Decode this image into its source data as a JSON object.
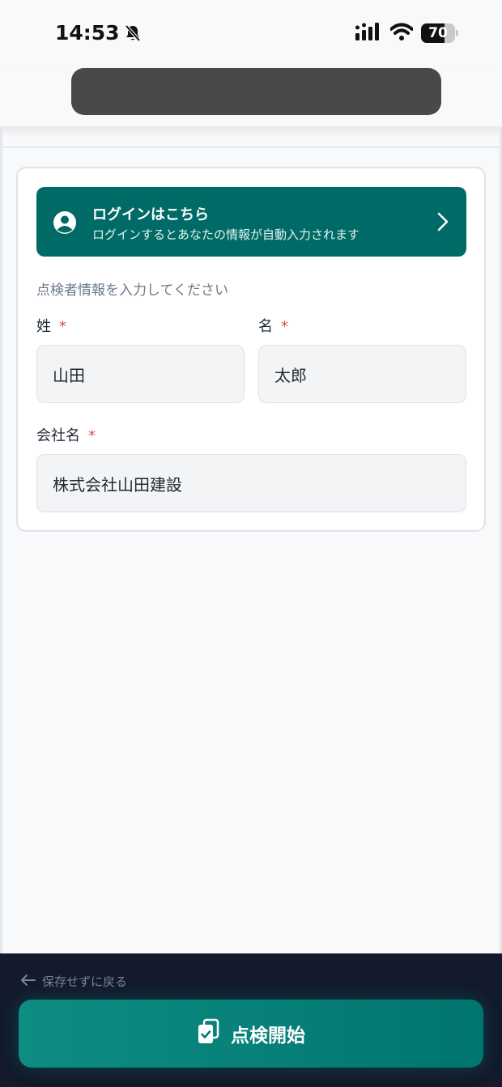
{
  "status": {
    "time": "14:53",
    "battery": "70",
    "battery_level": 0.7
  },
  "login": {
    "title": "ログインはこちら",
    "subtitle": "ログインするとあなたの情報が自動入力されます"
  },
  "form": {
    "hint": "点検者情報を入力してください",
    "required_mark": "*",
    "last_name_label": "姓",
    "last_name_value": "山田",
    "first_name_label": "名",
    "first_name_value": "太郎",
    "company_label": "会社名",
    "company_value": "株式会社山田建設"
  },
  "footer": {
    "back_label": "保存せずに戻る",
    "start_label": "点検開始"
  },
  "colors": {
    "brand": "#006b66",
    "footer_bg": "#121a2b",
    "required": "#e04b4b"
  }
}
